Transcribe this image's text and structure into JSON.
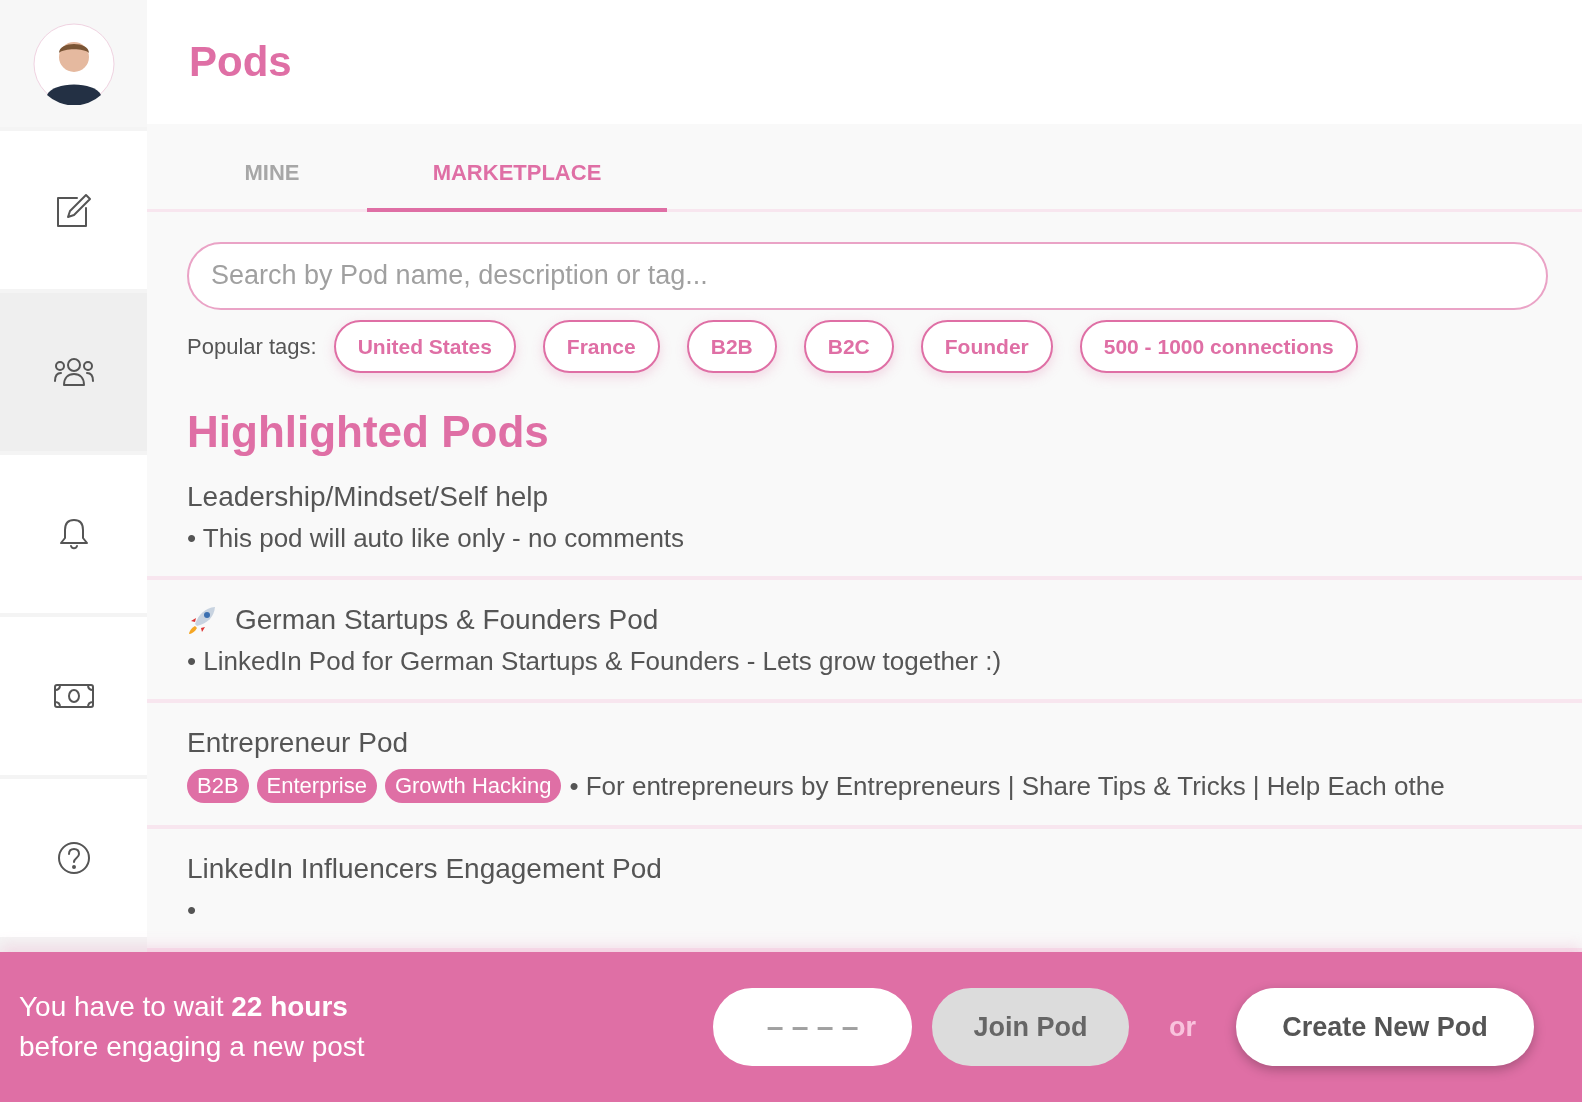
{
  "sidebar": {
    "items": [
      {
        "kind": "edit",
        "selected": false
      },
      {
        "kind": "people",
        "selected": true
      },
      {
        "kind": "bell",
        "selected": false
      },
      {
        "kind": "money",
        "selected": false
      },
      {
        "kind": "help",
        "selected": false
      }
    ]
  },
  "header": {
    "title": "Pods"
  },
  "tabs": [
    {
      "label": "MINE",
      "selected": false
    },
    {
      "label": "MARKETPLACE",
      "selected": true
    }
  ],
  "search": {
    "placeholder": "Search by Pod name, description or tag..."
  },
  "popular_tags": {
    "label": "Popular tags:",
    "tags": [
      "United States",
      "France",
      "B2B",
      "B2C",
      "Founder",
      "500 - 1000 connections"
    ]
  },
  "section_title": "Highlighted Pods",
  "pods": [
    {
      "name": "Leadership/Mindset/Self help",
      "rocket": false,
      "description": "• This pod will auto like only - no comments"
    },
    {
      "name": "German Startups & Founders Pod",
      "rocket": true,
      "description": "• LinkedIn Pod for German Startups & Founders - Lets grow together :)"
    },
    {
      "name": "Entrepreneur Pod",
      "rocket": false,
      "tags": [
        "B2B",
        "Enterprise",
        "Growth Hacking"
      ],
      "description": "• For entrepreneurs by Entrepreneurs | Share Tips & Tricks | Help Each othe"
    },
    {
      "name": "LinkedIn Influencers Engagement Pod",
      "rocket": false,
      "description": "•"
    }
  ],
  "footer": {
    "message": "You have to wait **22 hours** before engaging a new post",
    "code_placeholder": "– – – –",
    "join_button": "Join Pod",
    "or": "or",
    "create_button": "Create New Pod"
  }
}
